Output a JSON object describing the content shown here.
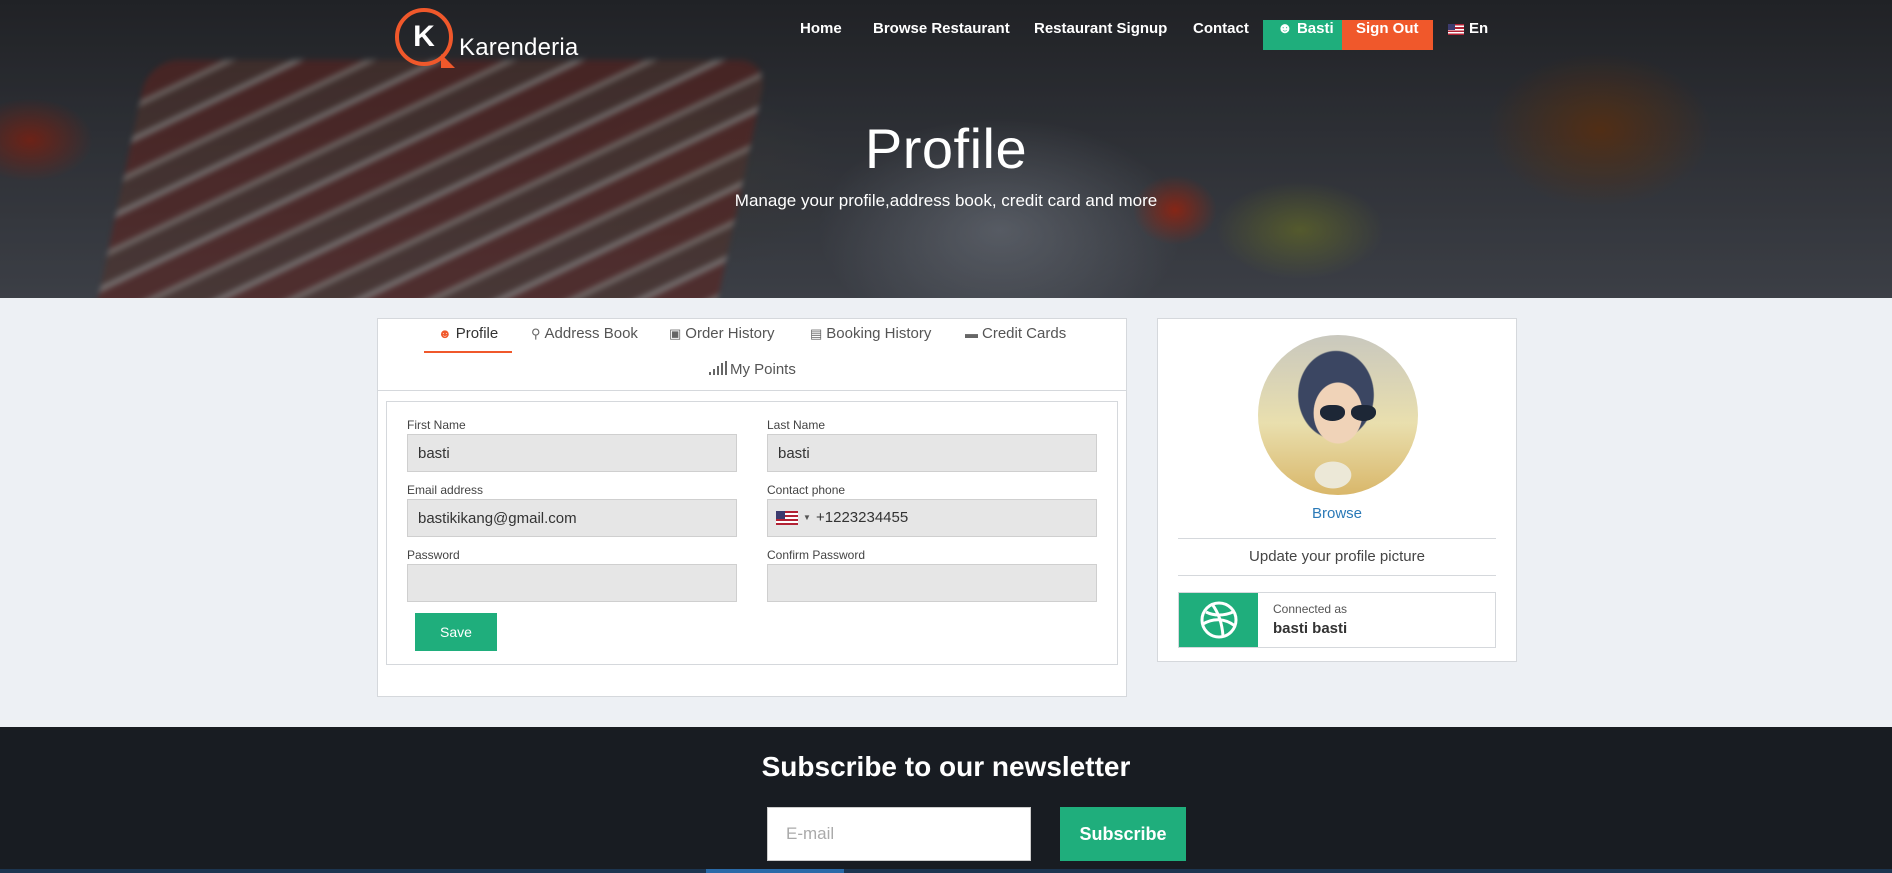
{
  "brand": {
    "name": "Karenderia",
    "logo_letter": "K"
  },
  "nav": {
    "home": "Home",
    "browse": "Browse Restaurant",
    "signup": "Restaurant Signup",
    "contact": "Contact",
    "user": "Basti",
    "signout": "Sign Out",
    "language": "En"
  },
  "hero": {
    "title": "Profile",
    "subtitle": "Manage your profile,address book, credit card and more"
  },
  "tabs": [
    {
      "label": "Profile",
      "icon": "user-icon",
      "active": true
    },
    {
      "label": "Address Book",
      "icon": "map-pin-icon",
      "active": false
    },
    {
      "label": "Order History",
      "icon": "book-icon",
      "active": false
    },
    {
      "label": "Booking History",
      "icon": "book-open-icon",
      "active": false
    },
    {
      "label": "Credit Cards",
      "icon": "credit-card-icon",
      "active": false
    },
    {
      "label": "My Points",
      "icon": "signal-bars-icon",
      "active": false
    }
  ],
  "form": {
    "first_name_label": "First Name",
    "first_name_value": "basti",
    "last_name_label": "Last Name",
    "last_name_value": "basti",
    "email_label": "Email address",
    "email_value": "bastikikang@gmail.com",
    "phone_label": "Contact phone",
    "phone_value": "+1223234455",
    "password_label": "Password",
    "password_value": "",
    "confirm_label": "Confirm Password",
    "confirm_value": "",
    "save_label": "Save"
  },
  "profile_card": {
    "browse_label": "Browse",
    "update_text": "Update your profile picture",
    "connected_as_label": "Connected as",
    "connected_name": "basti basti",
    "connected_icon": "dribbble-icon"
  },
  "newsletter": {
    "title": "Subscribe to our newsletter",
    "email_placeholder": "E-mail",
    "subscribe_label": "Subscribe"
  },
  "colors": {
    "accent_green": "#1fae7c",
    "accent_orange": "#f0582b",
    "link_blue": "#2a79b7"
  }
}
